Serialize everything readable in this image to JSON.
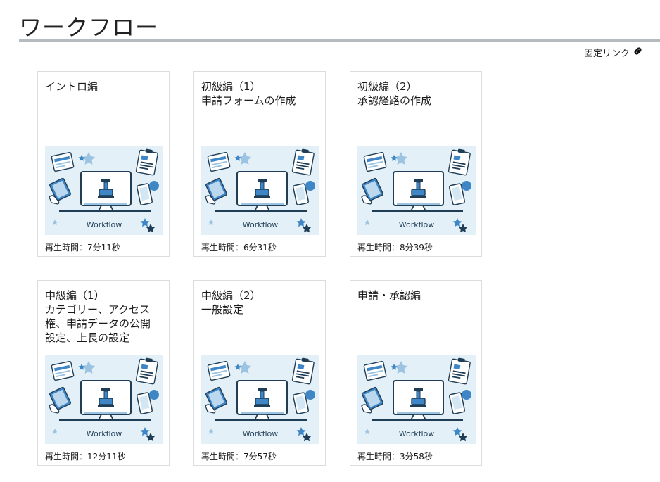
{
  "page": {
    "title": "ワークフロー",
    "permalink_label": "固定リンク",
    "permalink_icon": "link-icon"
  },
  "thumbnail": {
    "caption": "Workflow",
    "bg_color": "#e3f0f8",
    "accent_color": "#3f86c6",
    "dark_color": "#1f3d55"
  },
  "videos": [
    {
      "title": "イントロ編",
      "duration": "再生時間：7分11秒"
    },
    {
      "title": "初級編（1）\n申請フォームの作成",
      "duration": "再生時間：6分31秒"
    },
    {
      "title": "初級編（2）\n承認経路の作成",
      "duration": "再生時間：8分39秒"
    },
    {
      "title": "中級編（1）\nカテゴリー、アクセス\n権、申請データの公開\n設定、上長の設定",
      "duration": "再生時間：12分11秒"
    },
    {
      "title": "中級編（2）\n一般設定",
      "duration": "再生時間：7分57秒"
    },
    {
      "title": "申請・承認編",
      "duration": "再生時間：3分58秒"
    }
  ]
}
